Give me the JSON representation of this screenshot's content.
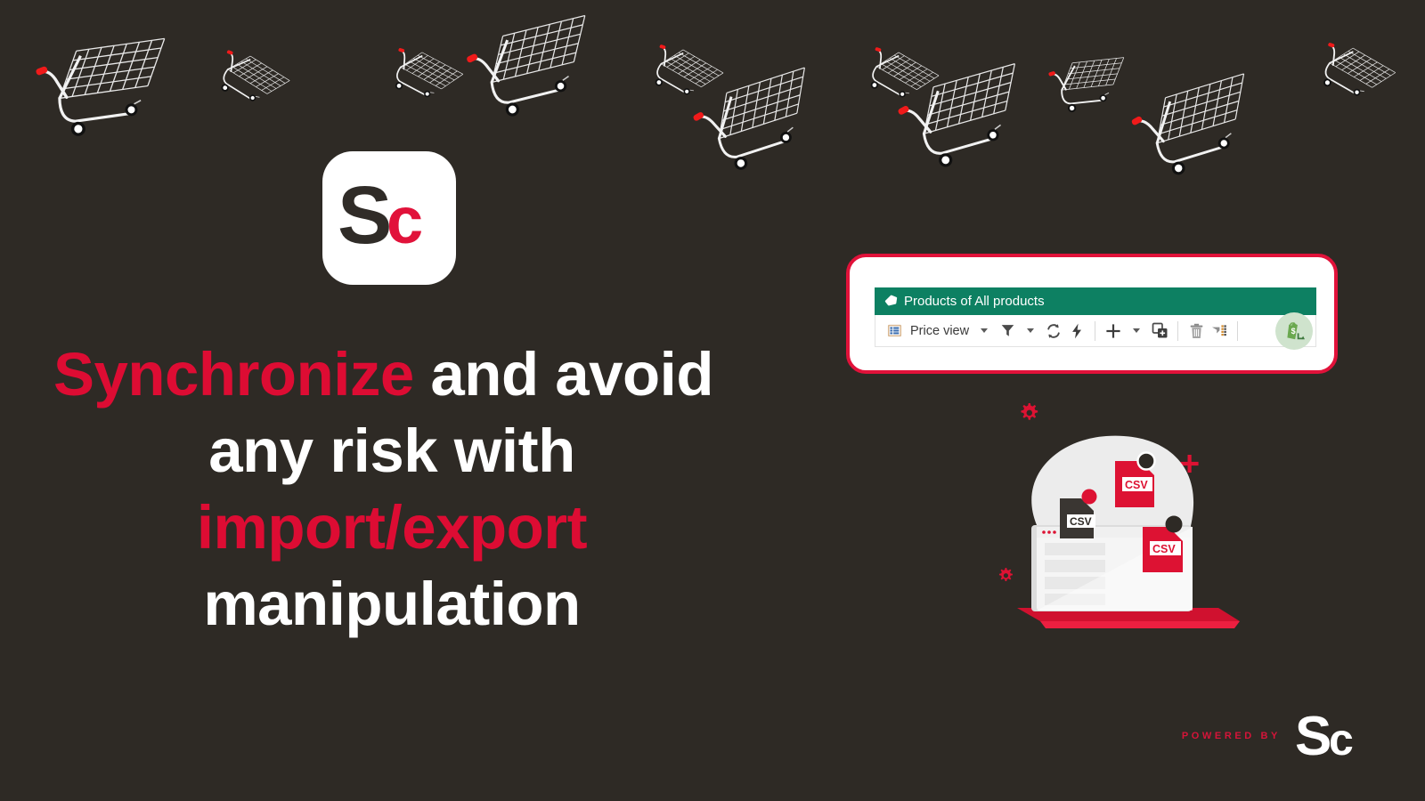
{
  "page": {
    "background_color": "#2e2a25",
    "accent_red": "#dd0c33",
    "accent_green": "#0d8062",
    "white": "#ffffff"
  },
  "brand": {
    "logo_letters_dark": "S",
    "logo_letters_red": "c",
    "logo_tile_color": "#ffffff"
  },
  "headline": {
    "line1_highlight": "Synchronize",
    "line1_rest": " and avoid",
    "line2": "any risk with",
    "line3_highlight": "import/export",
    "line4": "manipulation"
  },
  "toolbar_card": {
    "header": {
      "icon": "tag-icon",
      "title": "Products of All products"
    },
    "bar": {
      "view_icon": "list-view-icon",
      "view_label": "Price view",
      "view_caret": "chevron-down-icon",
      "filter_icon": "funnel-filter-icon",
      "filter_caret": "chevron-down-icon",
      "refresh_icon": "refresh-sync-icon",
      "flash_icon": "lightning-bolt-icon",
      "add_icon": "plus-icon",
      "add_caret": "chevron-down-icon",
      "duplicate_icon": "duplicate-add-icon",
      "delete_icon": "trash-bin-icon",
      "columns_icon": "column-settings-icon",
      "export_icon": "shopify-bag-download-icon"
    }
  },
  "illustration": {
    "name": "csv-import-export-laptop-illustration",
    "file_badges": [
      "CSV",
      "CSV",
      "CSV"
    ],
    "gear_icons": [
      "gear-icon",
      "gear-icon"
    ],
    "plus_icon": "plus-icon"
  },
  "decor": {
    "carts_label": "shopping-cart-pattern",
    "cart_count": 11
  },
  "footer": {
    "powered_by": "POWERED BY",
    "logo_letters_s": "S",
    "logo_letters_c": "c"
  }
}
